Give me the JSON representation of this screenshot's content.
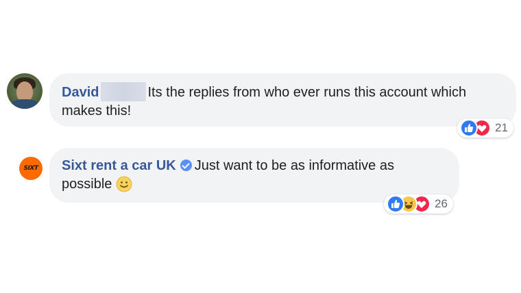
{
  "comments": [
    {
      "author": "David",
      "text": "Its the replies from who ever runs this account which makes this!",
      "reactions": [
        "like-icon",
        "love-icon"
      ],
      "reaction_count": "21"
    },
    {
      "author": "Sixt rent a car UK",
      "avatar_text": "SIXT",
      "text": "Just want to be as informative as possible",
      "reactions": [
        "like-icon",
        "haha-icon",
        "love-icon"
      ],
      "reaction_count": "26"
    }
  ],
  "colors": {
    "author_link": "#385898",
    "bubble_bg": "#f2f3f5",
    "like": "#2f7bf5",
    "love": "#f0284a",
    "haha": "#f7c64a",
    "sixt_orange": "#ff6a00"
  }
}
